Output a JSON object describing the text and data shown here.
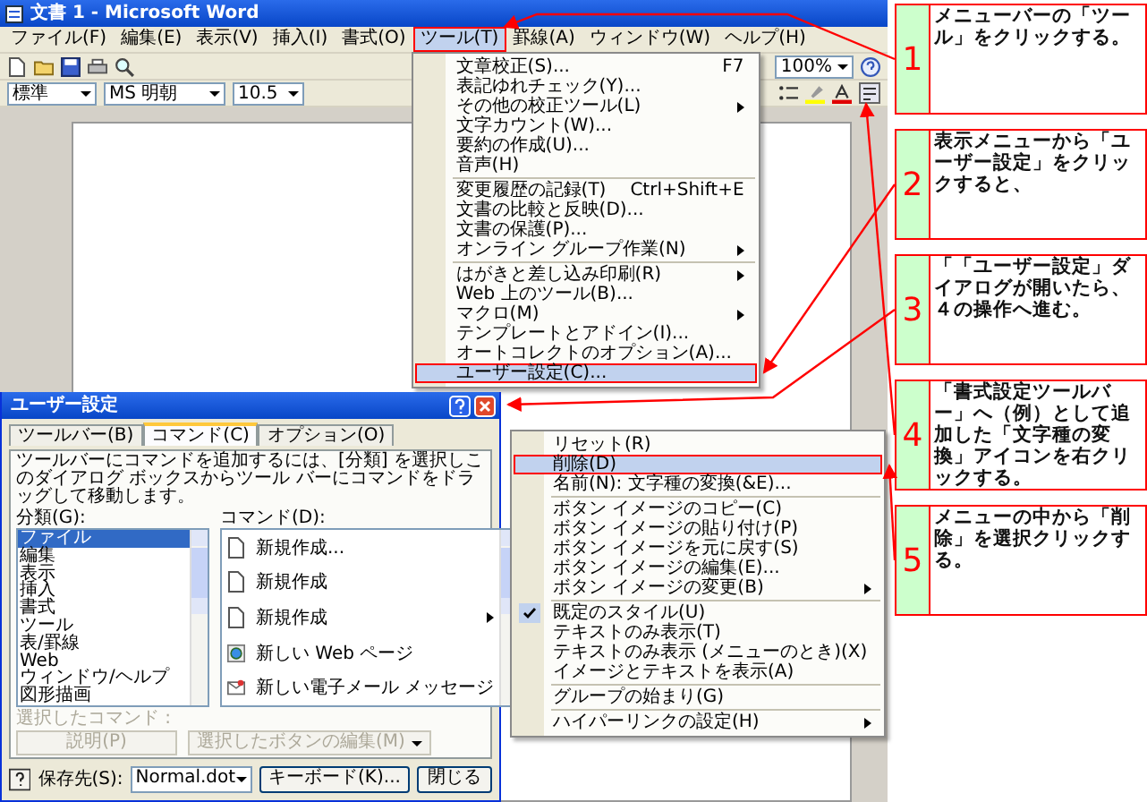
{
  "window": {
    "title": "文書 1 - Microsoft Word"
  },
  "menu_bar": [
    {
      "label": "ファイル(F)",
      "selected": false
    },
    {
      "label": "編集(E)",
      "selected": false
    },
    {
      "label": "表示(V)",
      "selected": false
    },
    {
      "label": "挿入(I)",
      "selected": false
    },
    {
      "label": "書式(O)",
      "selected": false
    },
    {
      "label": "ツール(T)",
      "selected": true
    },
    {
      "label": "罫線(A)",
      "selected": false
    },
    {
      "label": "ウィンドウ(W)",
      "selected": false
    },
    {
      "label": "ヘルプ(H)",
      "selected": false
    }
  ],
  "standard_toolbar": {
    "zoom": "100%"
  },
  "formatting_toolbar": {
    "style": "標準",
    "font": "MS 明朝",
    "size": "10.5"
  },
  "tools_menu": {
    "groups": [
      [
        {
          "label": "文章校正(S)...",
          "shortcut": "F7",
          "submenu": false,
          "selected": false
        },
        {
          "label": "表記ゆれチェック(Y)...",
          "submenu": false,
          "selected": false
        },
        {
          "label": "その他の校正ツール(L)",
          "submenu": true,
          "selected": false
        },
        {
          "label": "文字カウント(W)...",
          "submenu": false,
          "selected": false
        },
        {
          "label": "要約の作成(U)...",
          "submenu": false,
          "selected": false
        },
        {
          "label": "音声(H)",
          "submenu": false,
          "selected": false
        }
      ],
      [
        {
          "label": "変更履歴の記録(T)",
          "shortcut": "Ctrl+Shift+E",
          "submenu": false,
          "selected": false
        },
        {
          "label": "文書の比較と反映(D)...",
          "submenu": false,
          "selected": false
        },
        {
          "label": "文書の保護(P)...",
          "submenu": false,
          "selected": false
        },
        {
          "label": "オンライン グループ作業(N)",
          "submenu": true,
          "selected": false
        }
      ],
      [
        {
          "label": "はがきと差し込み印刷(R)",
          "submenu": true,
          "selected": false
        },
        {
          "label": "Web 上のツール(B)...",
          "submenu": false,
          "selected": false
        },
        {
          "label": "マクロ(M)",
          "submenu": true,
          "selected": false
        },
        {
          "label": "テンプレートとアドイン(I)...",
          "submenu": false,
          "selected": false
        },
        {
          "label": "オートコレクトのオプション(A)...",
          "submenu": false,
          "selected": false
        },
        {
          "label": "ユーザー設定(C)...",
          "submenu": false,
          "selected": true
        }
      ]
    ]
  },
  "customize_dialog": {
    "title": "ユーザー設定",
    "tabs": [
      {
        "label": "ツールバー(B)",
        "selected": false
      },
      {
        "label": "コマンド(C)",
        "selected": true
      },
      {
        "label": "オプション(O)",
        "selected": false
      }
    ],
    "instructions": "ツールバーにコマンドを追加するには、[分類] を選択しこのダイアログ ボックスからツール バーにコマンドをドラッグして移動します。",
    "categories_label": "分類(G):",
    "categories": [
      {
        "label": "ファイル",
        "selected": true
      },
      {
        "label": "編集",
        "selected": false
      },
      {
        "label": "表示",
        "selected": false
      },
      {
        "label": "挿入",
        "selected": false
      },
      {
        "label": "書式",
        "selected": false
      },
      {
        "label": "ツール",
        "selected": false
      },
      {
        "label": "表/罫線",
        "selected": false
      },
      {
        "label": "Web",
        "selected": false
      },
      {
        "label": "ウィンドウ/ヘルプ",
        "selected": false
      },
      {
        "label": "図形描画",
        "selected": false
      }
    ],
    "commands_label": "コマンド(D):",
    "commands": [
      {
        "label": "新規作成...",
        "kind": "document",
        "submenu": false
      },
      {
        "label": "新規作成",
        "kind": "document",
        "submenu": false
      },
      {
        "label": "新規作成",
        "kind": "document",
        "submenu": true
      },
      {
        "label": "新しい Web ページ",
        "kind": "web",
        "submenu": false
      },
      {
        "label": "新しい電子メール メッセージ",
        "kind": "mail",
        "submenu": false
      }
    ],
    "selected_command_label": "選択したコマンド :",
    "buttons": [
      {
        "label": "説明(P)",
        "disabled": true,
        "dropdown": false
      },
      {
        "label": "選択したボタンの編集(M)",
        "disabled": true,
        "dropdown": true
      }
    ],
    "save_in_label": "保存先(S):",
    "save_in": "Normal.dot",
    "keyboard_button": "キーボード(K)...",
    "close_button": "閉じる"
  },
  "context_menu": {
    "groups": [
      [
        {
          "label": "リセット(R)",
          "selected": false,
          "checked": false,
          "submenu": false
        },
        {
          "label": "削除(D)",
          "selected": true,
          "checked": false,
          "submenu": false
        },
        {
          "label": "名前(N):  文字種の変換(&E)...",
          "selected": false,
          "checked": false,
          "submenu": false
        }
      ],
      [
        {
          "label": "ボタン イメージのコピー(C)",
          "selected": false,
          "checked": false,
          "submenu": false
        },
        {
          "label": "ボタン イメージの貼り付け(P)",
          "selected": false,
          "checked": false,
          "submenu": false
        },
        {
          "label": "ボタン イメージを元に戻す(S)",
          "selected": false,
          "checked": false,
          "submenu": false
        },
        {
          "label": "ボタン イメージの編集(E)...",
          "selected": false,
          "checked": false,
          "submenu": false
        },
        {
          "label": "ボタン イメージの変更(B)",
          "selected": false,
          "checked": false,
          "submenu": true
        }
      ],
      [
        {
          "label": "既定のスタイル(U)",
          "selected": false,
          "checked": true,
          "submenu": false
        },
        {
          "label": "テキストのみ表示(T)",
          "selected": false,
          "checked": false,
          "submenu": false
        },
        {
          "label": "テキストのみ表示 (メニューのとき)(X)",
          "selected": false,
          "checked": false,
          "submenu": false
        },
        {
          "label": "イメージとテキストを表示(A)",
          "selected": false,
          "checked": false,
          "submenu": false
        }
      ],
      [
        {
          "label": "グループの始まり(G)",
          "selected": false,
          "checked": false,
          "submenu": false
        }
      ],
      [
        {
          "label": "ハイパーリンクの設定(H)",
          "selected": false,
          "checked": false,
          "submenu": true
        }
      ]
    ]
  },
  "steps": [
    {
      "number": "1",
      "text": "メニューバーの「ツール」をクリックする。"
    },
    {
      "number": "2",
      "text": "表示メニューから「ユーザー設定」をクリックすると、"
    },
    {
      "number": "3",
      "text": "「「ユーザー設定」ダイアログが開いたら、４の操作へ進む。"
    },
    {
      "number": "4",
      "text": "「書式設定ツールバー」へ（例）として追加した「文字種の変換」アイコンを右クリックする。"
    },
    {
      "number": "5",
      "text": "メニューの中から「削除」を選択クリックする。"
    }
  ]
}
